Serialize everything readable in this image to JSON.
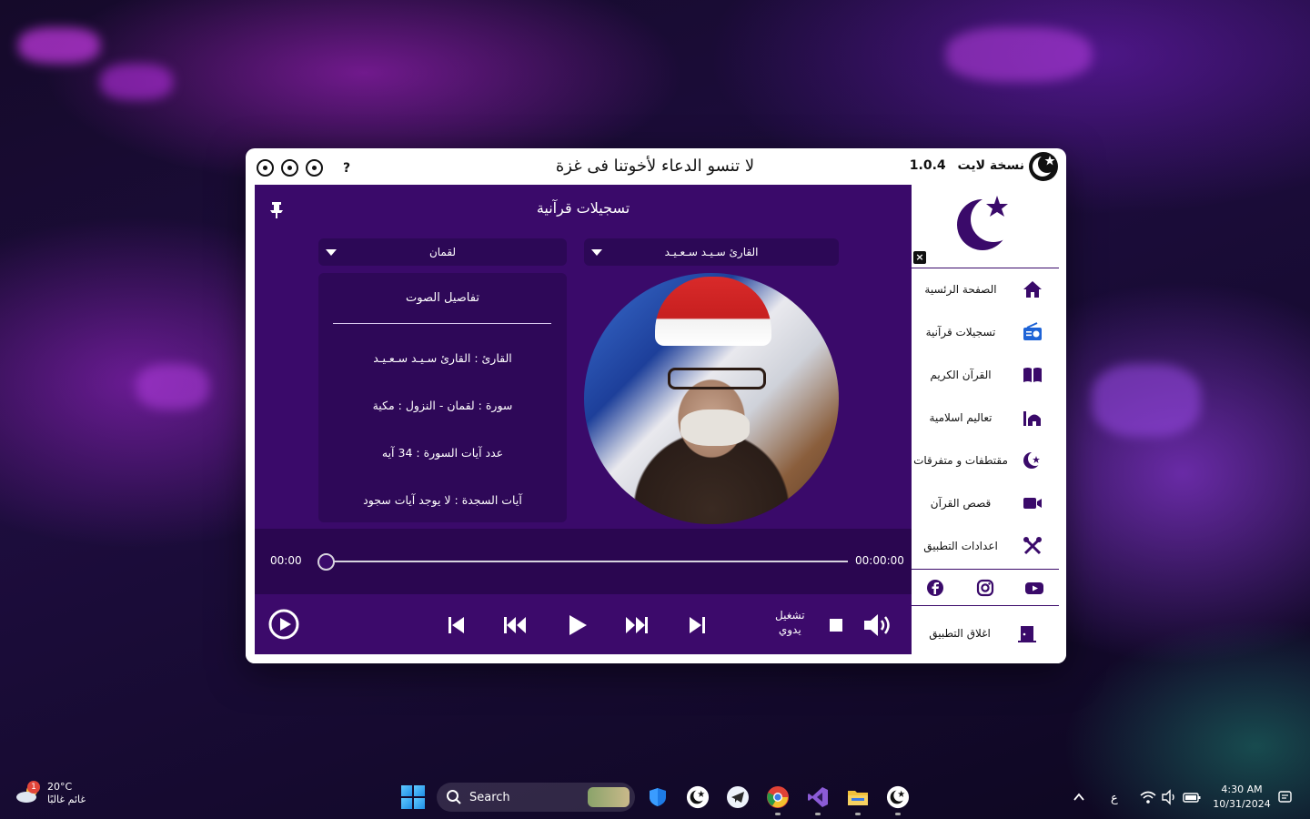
{
  "window": {
    "title": "لا تنسو الدعاء لأخوتنا فى غزة",
    "version_label": "نسخة لايت",
    "version_number": "1.0.4",
    "help_label": "?"
  },
  "main": {
    "title": "تسجيلات قرآنية",
    "reciter_dropdown": "القارئ سـيـد سـعـيـد",
    "surah_dropdown": "لقمان",
    "details": {
      "title": "تفاصيل الصوت",
      "reciter": "القارئ : القارئ سـيـد سـعـيـد",
      "surah": "سورة  :  لقمان  -  النزول  :  مكية",
      "ayat_count": "عدد آيات السورة :  34  آيه",
      "sajda": "آيات السجدة  :  لا يوجد آيات سجود"
    },
    "player": {
      "elapsed": "00:00",
      "duration": "00:00:00",
      "progress": 0,
      "manual_line1": "تشغيل",
      "manual_line2": "يدوي"
    }
  },
  "sidebar": {
    "close_label": "×",
    "items": [
      {
        "label": "الصفحة الرئسية",
        "icon": "home-icon"
      },
      {
        "label": "تسجيلات قرآنية",
        "icon": "radio-icon"
      },
      {
        "label": "القرآن الكريم",
        "icon": "book-icon"
      },
      {
        "label": "تعاليم اسلامية",
        "icon": "mosque-icon"
      },
      {
        "label": "مقتطفات و متفرقات",
        "icon": "crescent-star-icon"
      },
      {
        "label": "قصص القرآن",
        "icon": "video-camera-icon"
      },
      {
        "label": "اعدادات التطبيق",
        "icon": "tools-icon"
      }
    ],
    "exit_label": "اغلاق التطبيق",
    "socials": [
      "facebook-icon",
      "instagram-icon",
      "youtube-icon"
    ]
  },
  "taskbar": {
    "weather_temp": "20°C",
    "weather_desc": "غائم غالبًا",
    "weather_badge": "1",
    "search_placeholder": "Search",
    "lang": "ع",
    "time": "4:30 AM",
    "date": "10/31/2024"
  },
  "colors": {
    "panel": "#3a0a6a",
    "panel_dark": "#2b0657",
    "accent_active": "#1e63d6"
  }
}
